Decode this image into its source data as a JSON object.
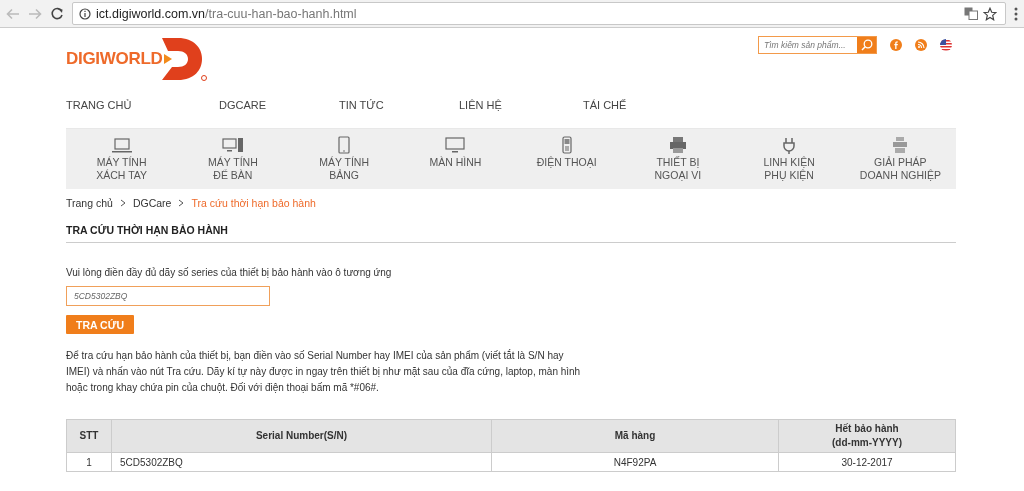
{
  "browser": {
    "url_host": "ict.digiworld.com.vn",
    "url_path": "/tra-cuu-han-bao-hanh.html"
  },
  "header": {
    "logo": "DIGIWORLD",
    "search": {
      "placeholder": "Tìm kiếm sản phẩm..."
    }
  },
  "nav": [
    "TRANG CHỦ",
    "DGCARE",
    "TIN TỨC",
    "LIÊN HỆ",
    "TÁI CHẾ"
  ],
  "categories": [
    {
      "kind": "laptop",
      "label": "MÁY TÍNH\nXÁCH TAY"
    },
    {
      "kind": "desktop",
      "label": "MÁY TÍNH\nĐỂ BÀN"
    },
    {
      "kind": "tablet",
      "label": "MÁY TÍNH\nBẢNG"
    },
    {
      "kind": "monitor",
      "label": "MÀN HÌNH"
    },
    {
      "kind": "phone",
      "label": "ĐIỆN THOẠI"
    },
    {
      "kind": "printer",
      "label": "THIẾT BỊ\nNGOẠI VI"
    },
    {
      "kind": "cable",
      "label": "LINH KIỆN\nPHỤ KIỆN"
    },
    {
      "kind": "server",
      "label": "GIẢI PHÁP\nDOANH NGHIỆP"
    }
  ],
  "breadcrumb": [
    "Trang chủ",
    "DGCare",
    "Tra cứu thời hạn bảo hành"
  ],
  "heading": "TRA CỨU THỜI HẠN BẢO HÀNH",
  "instruction": "Vui lòng điền đầy đủ dãy số series của thiết bị bảo hành vào ô tương ứng",
  "serial_field": {
    "value": "5CD5302ZBQ"
  },
  "submit_button": "TRA CỨU",
  "help_text": "Để tra cứu hạn bảo hành của thiết bị, bạn điền vào số Serial Number hay IMEI của sản phẩm (viết tắt là S/N hay IMEI) và nhấn vào nút Tra cứu. Dãy kí tự này được in ngay trên thiết bị như mặt sau của đĩa cứng, laptop, màn hình hoặc trong khay chứa pin của chuột. Đối với điện thoại bấm mã *#06#.",
  "table": {
    "columns": [
      "STT",
      "Serial Number(S/N)",
      "Mã hàng",
      "Hết bảo hành\n(dd-mm-YYYY)"
    ],
    "rows": [
      [
        "1",
        "5CD5302ZBQ",
        "N4F92PA",
        "30-12-2017"
      ]
    ]
  }
}
